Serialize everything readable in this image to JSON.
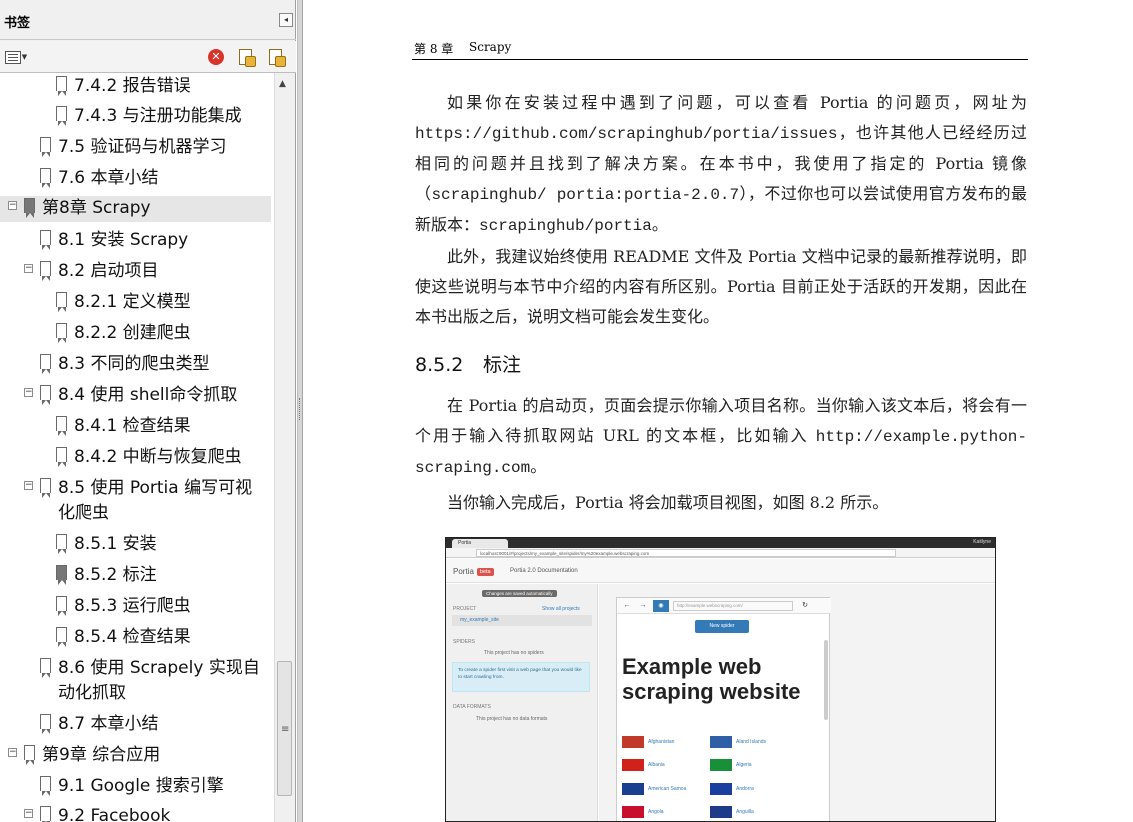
{
  "bookmarks": {
    "title": "书签",
    "collapse_symbol": "◂",
    "toolbar": {
      "options_icon": "options-menu-icon",
      "delete_icon": "delete-bookmark-icon",
      "new_icon": "new-bookmark-icon",
      "expand_icon": "expand-bookmark-icon"
    },
    "items": [
      {
        "label": "7.4.2  报告错误"
      },
      {
        "label": "7.4.3  与注册功能集成"
      },
      {
        "label": "7.5  验证码与机器学习"
      },
      {
        "label": "7.6  本章小结"
      },
      {
        "label": "第8章    Scrapy"
      },
      {
        "label": "8.1 安装 Scrapy"
      },
      {
        "label": "8.2  启动项目"
      },
      {
        "label": "8.2.1  定义模型"
      },
      {
        "label": "8.2.2  创建爬虫"
      },
      {
        "label": "8.3  不同的爬虫类型"
      },
      {
        "label": "8.4  使用 shell命令抓取"
      },
      {
        "label": "8.4.1  检查结果"
      },
      {
        "label": "8.4.2  中断与恢复爬虫"
      },
      {
        "label": "8.5  使用 Portia 编写可视化爬虫"
      },
      {
        "label": "8.5.1  安装"
      },
      {
        "label": "8.5.2  标注"
      },
      {
        "label": "8.5.3  运行爬虫"
      },
      {
        "label": "8.5.4  检查结果"
      },
      {
        "label": "8.6  使用 Scrapely 实现自动化抓取"
      },
      {
        "label": "8.7  本章小结"
      },
      {
        "label": "第9章    综合应用"
      },
      {
        "label": "9.1 Google 搜索引擎"
      },
      {
        "label": "9.2  Facebook"
      }
    ],
    "toggle_minus": "−"
  },
  "page": {
    "header": {
      "chapter": "第 8 章",
      "title": "Scrapy"
    },
    "p1": {
      "t1": "如果你在安装过程中遇到了问题，可以查看 Portia 的问题页，网址为",
      "code1": "https://github.com/scrapinghub/portia/issues",
      "t2": "，也许其他人已经经历过相同的问题并且找到了解决方案。在本书中，我使用了指定的 Portia 镜像（",
      "code2": "scrapinghub/ portia:portia-2.0.7",
      "t3": "），不过你也可以尝试使用官方发布的最新版本：",
      "code3": "scrapinghub/portia",
      "t4": "。"
    },
    "p2": "此外，我建议始终使用 README 文件及 Portia 文档中记录的最新推荐说明，即使这些说明与本节中介绍的内容有所区别。Portia 目前正处于活跃的开发期，因此在本书出版之后，说明文档可能会发生变化。",
    "section": {
      "num": "8.5.2",
      "title": "标注"
    },
    "p3": {
      "t1": "在 Portia 的启动页，页面会提示你输入项目名称。当你输入该文本后，将会有一个用于输入待抓取网站 URL 的文本框，比如输入 ",
      "code": "http://example.python-scraping.com",
      "t2": "。"
    },
    "p4": "当你输入完成后，Portia 将会加载项目视图，如图 8.2 所示。"
  },
  "figure": {
    "tab_title": "Portia",
    "window_user": "Kaitlyne",
    "url": "localhost:9001/#/projects/my_example_site/spider/my%20example.webscraping.com",
    "brand": "Portia",
    "beta": "beta",
    "docs": "Portia 2.0 Documentation",
    "saved": "Changes are saved automatically",
    "project_label": "PROJECT",
    "show_all": "Show all projects",
    "project_name": "my_example_site",
    "spiders_label": "SPIDERS",
    "no_spiders": "This project has no spiders",
    "tip": "To create a spider first visit a web page that you would like to start crawling from.",
    "data_formats_label": "DATA FORMATS",
    "no_data": "This project has no data formats",
    "browser_url": "http://example.webscraping.com/",
    "new_spider": "New spider",
    "heading": "Example web scraping website",
    "countries": [
      {
        "name": "Afghanistan",
        "flag": "#c0392b"
      },
      {
        "name": "Aland Islands",
        "flag": "#2f5fa7"
      },
      {
        "name": "Albania",
        "flag": "#d0211b"
      },
      {
        "name": "Algeria",
        "flag": "#1a8f3a"
      },
      {
        "name": "American Samoa",
        "flag": "#1b3f8f"
      },
      {
        "name": "Andorra",
        "flag": "#1a3fa0"
      },
      {
        "name": "Angola",
        "flag": "#c8102e"
      },
      {
        "name": "Anguilla",
        "flag": "#1f3c88"
      }
    ]
  }
}
